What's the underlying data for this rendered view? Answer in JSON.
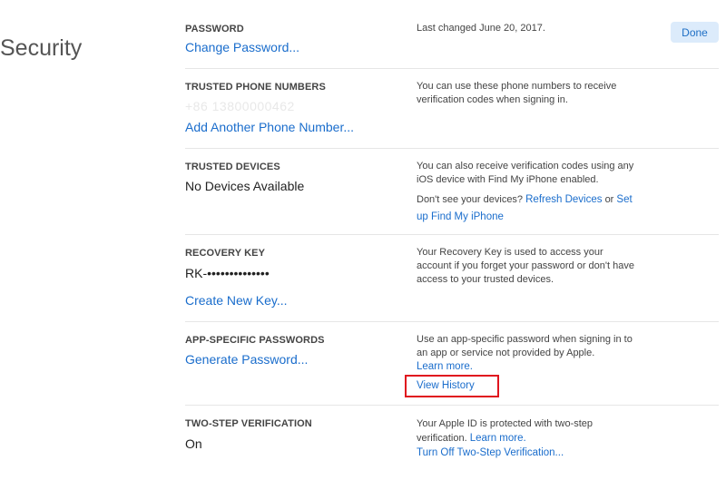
{
  "page": {
    "title": "Security",
    "done_label": "Done"
  },
  "sections": {
    "password": {
      "label": "PASSWORD",
      "action": "Change Password...",
      "desc": "Last changed June 20, 2017."
    },
    "phones": {
      "label": "TRUSTED PHONE NUMBERS",
      "number": "+86 13800000462",
      "action": "Add Another Phone Number...",
      "desc": "You can use these phone numbers to receive verification codes when signing in."
    },
    "devices": {
      "label": "TRUSTED DEVICES",
      "value": "No Devices Available",
      "desc": "You can also receive verification codes using any iOS device with Find My iPhone enabled.",
      "prompt": "Don't see your devices?",
      "refresh_link": "Refresh Devices",
      "or": "or",
      "setup_link": "Set up Find My iPhone"
    },
    "recovery": {
      "label": "RECOVERY KEY",
      "value": "RK-••••••••••••••",
      "action": "Create New Key...",
      "desc": "Your Recovery Key is used to access your account if you forget your password or don't have access to your trusted devices."
    },
    "app_passwords": {
      "label": "APP-SPECIFIC PASSWORDS",
      "action": "Generate Password...",
      "desc": "Use an app-specific password when signing in to an app or service not provided by Apple.",
      "learn_more": "Learn more.",
      "view_history": "View History"
    },
    "two_step": {
      "label": "TWO-STEP VERIFICATION",
      "value": "On",
      "desc": "Your Apple ID is protected with two-step verification.",
      "learn_more": "Learn more.",
      "turn_off": "Turn Off Two-Step Verification..."
    }
  },
  "colors": {
    "link": "#1a6dcc",
    "done_bg": "#dcebfb",
    "highlight": "#e0141e"
  }
}
